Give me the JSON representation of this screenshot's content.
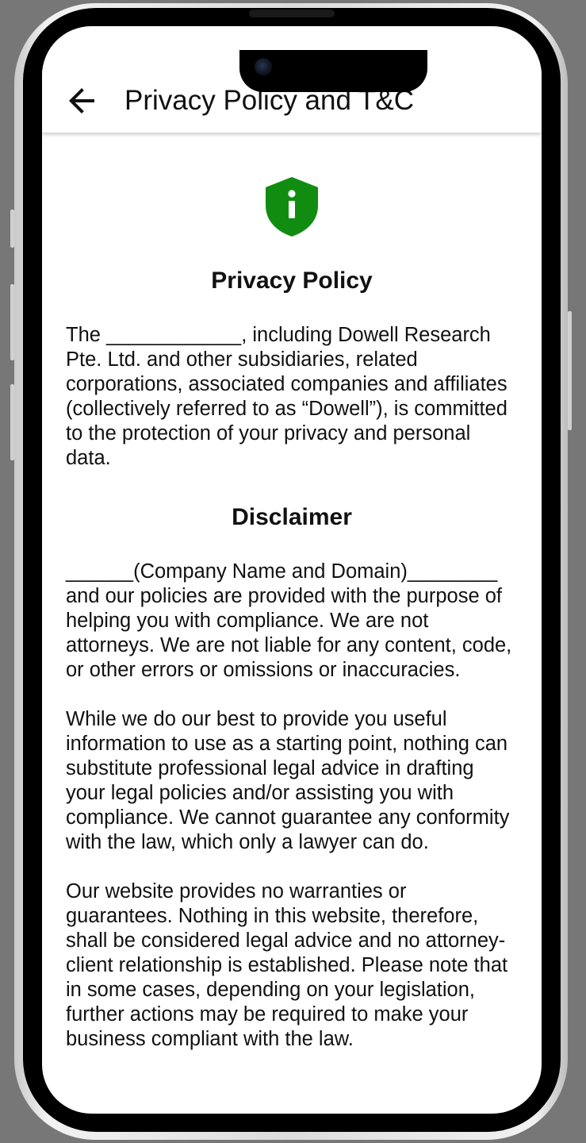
{
  "app_bar": {
    "title": "Privacy Policy and T&C",
    "back_icon": "arrow-left-icon"
  },
  "content": {
    "shield_icon": "shield-info-icon",
    "shield_color": "#108d10",
    "privacy_heading": "Privacy Policy",
    "privacy_text": "The ____________, including Dowell Research Pte. Ltd. and other subsidiaries, related corporations, associated companies and affiliates (collectively referred to as “Dowell”), is committed to the protection of your privacy and personal data.",
    "disclaimer_heading": "Disclaimer",
    "disclaimer_paragraphs": [
      "______(Company Name and Domain)________ and our policies are provided with the purpose of helping you with compliance. We are not attorneys. We are not liable for any content, code, or other errors or omissions or inaccuracies.",
      "While we do our best to provide you useful information to use as a starting point, nothing can substitute professional legal advice in drafting your legal policies and/or assisting you with compliance. We cannot guarantee any conformity with the law, which only a lawyer can do.",
      "Our website provides no warranties or guarantees. Nothing in this website, therefore, shall be considered legal advice and no attorney-client relationship is established. Please note that in some cases, depending on your legislation, further actions may be required to make your business compliant with the law."
    ]
  }
}
